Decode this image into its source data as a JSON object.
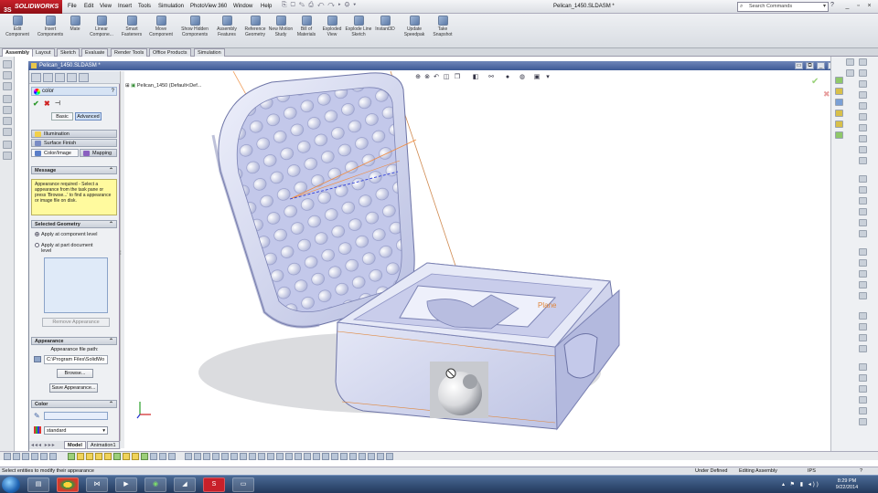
{
  "app": {
    "logo": "SOLIDWORKS",
    "logo_mark": "3S",
    "doc_title": "Pelican_1450.SLDASM *"
  },
  "menu": [
    "File",
    "Edit",
    "View",
    "Insert",
    "Tools",
    "Simulation",
    "PhotoView 360",
    "Window",
    "Help"
  ],
  "search": {
    "placeholder": "Search Commands",
    "icon": "search-icon"
  },
  "command_manager": [
    {
      "label": "Edit Component",
      "icon": "edit-component-icon"
    },
    {
      "label": "Insert Components",
      "icon": "insert-components-icon"
    },
    {
      "label": "Mate",
      "icon": "mate-icon"
    },
    {
      "label": "Linear Compone...",
      "icon": "linear-pattern-icon"
    },
    {
      "label": "Smart Fasteners",
      "icon": "smart-fasteners-icon"
    },
    {
      "label": "Move Component",
      "icon": "move-component-icon"
    },
    {
      "label": "Show Hidden Components",
      "icon": "show-hidden-icon"
    },
    {
      "label": "Assembly Features",
      "icon": "assembly-features-icon"
    },
    {
      "label": "Reference Geometry",
      "icon": "reference-geometry-icon"
    },
    {
      "label": "New Motion Study",
      "icon": "motion-study-icon"
    },
    {
      "label": "Bill of Materials",
      "icon": "bom-icon"
    },
    {
      "label": "Exploded View",
      "icon": "exploded-view-icon"
    },
    {
      "label": "Explode Line Sketch",
      "icon": "explode-line-icon"
    },
    {
      "label": "Instant3D",
      "icon": "instant3d-icon"
    },
    {
      "label": "Update Speedpak",
      "icon": "speedpak-icon"
    },
    {
      "label": "Take Snapshot",
      "icon": "snapshot-icon"
    }
  ],
  "tabs": [
    "Assembly",
    "Layout",
    "Sketch",
    "Evaluate",
    "Render Tools",
    "Office Products",
    "Simulation"
  ],
  "active_tab": "Assembly",
  "pm": {
    "title": "color",
    "basic": "Basic",
    "advanced": "Advanced",
    "prop_tabs": [
      "Illumination",
      "Surface Finish",
      "Color/Image",
      "Mapping"
    ],
    "message_title": "Message",
    "message_text": "Appearance required - Select a appearance from the task pane or press 'Browse...' to find a appearance or image file on disk.",
    "selected_geometry": "Selected Geometry",
    "radio_component": "Apply at component level",
    "radio_part": "Apply at part document level",
    "remove_btn": "Remove Appearance",
    "appearance_title": "Appearance",
    "file_path_label": "Appearance file path:",
    "file_path": "C:\\Program Files\\SolidWo",
    "browse_btn": "Browse...",
    "save_btn": "Save Appearance...",
    "color_title": "Color",
    "standard": "standard"
  },
  "tree": {
    "item": "Pelican_1450 (Default<Def..."
  },
  "viewport": {
    "plane_label": "Plane"
  },
  "bottom_tabs": [
    "Model",
    "Animation1"
  ],
  "status": {
    "left": "Select entities to modify their appearance",
    "definition": "Under Defined",
    "mode": "Editing Assembly",
    "units": "IPS"
  },
  "taskbar": {
    "time": "8:29 PM",
    "date": "9/22/2014"
  },
  "colors": {
    "accent": "#3e5a96",
    "model_fill": "#cfd3ee",
    "message_bg": "#fffa9e",
    "brand": "#c8202a"
  }
}
